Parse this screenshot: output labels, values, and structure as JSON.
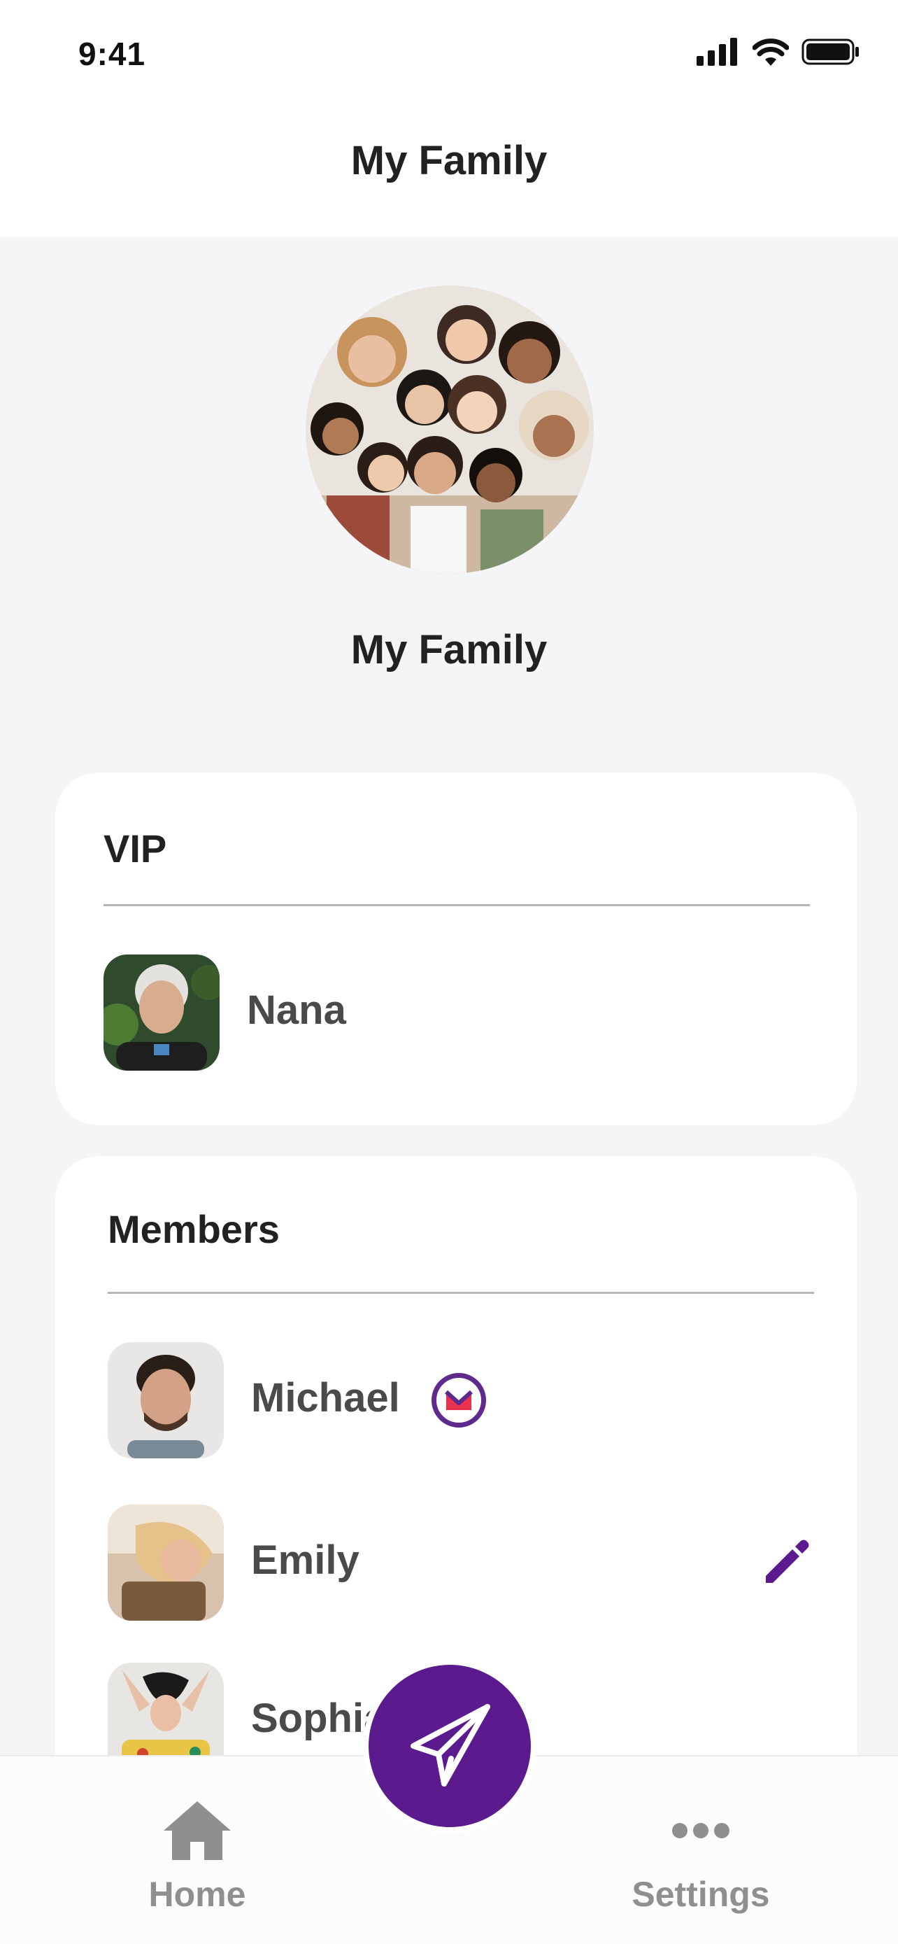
{
  "status_bar": {
    "time": "9:41"
  },
  "header": {
    "title": "My Family"
  },
  "group": {
    "name": "My Family"
  },
  "vip": {
    "title": "VIP",
    "members": [
      {
        "name": "Nana"
      }
    ]
  },
  "members": {
    "title": "Members",
    "items": [
      {
        "name": "Michael",
        "badge": "m-badge-icon"
      },
      {
        "name": "Emily",
        "action": "pencil-icon"
      },
      {
        "name": "Sophia"
      }
    ]
  },
  "tabbar": {
    "home_label": "Home",
    "settings_label": "Settings",
    "compose_icon": "paper-plane-icon"
  },
  "colors": {
    "accent": "#5b1a8d",
    "tab_inactive": "#8f8f8f",
    "background": "#f5f5f7",
    "card": "#ffffff"
  }
}
